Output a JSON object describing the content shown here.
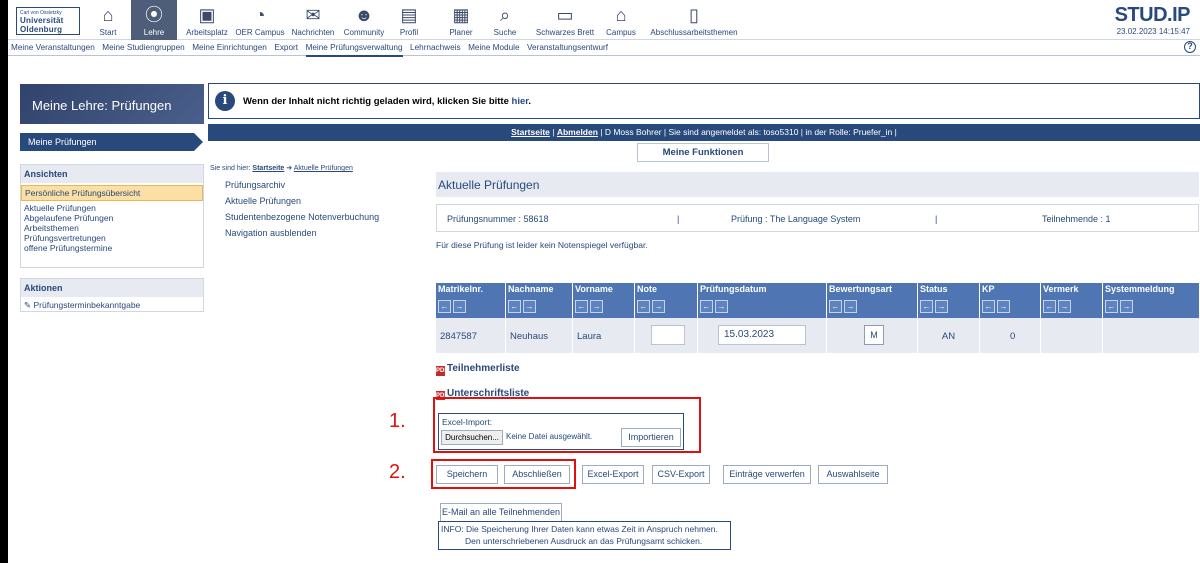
{
  "logo": {
    "small": "Carl von Ossietzky",
    "line1": "Universität",
    "line2": "Oldenburg"
  },
  "nav": [
    {
      "label": "Start",
      "icon": "home-icon",
      "glyph": "⌂"
    },
    {
      "label": "Lehre",
      "icon": "lehre-icon",
      "glyph": "⦿"
    },
    {
      "label": "Arbeitsplatz",
      "icon": "workplace-icon",
      "glyph": "▣"
    },
    {
      "label": "OER Campus",
      "icon": "oer-icon",
      "glyph": "◔"
    },
    {
      "label": "Nachrichten",
      "icon": "mail-icon",
      "glyph": "✉"
    },
    {
      "label": "Community",
      "icon": "community-icon",
      "glyph": "☻"
    },
    {
      "label": "Profil",
      "icon": "profile-icon",
      "glyph": "▤"
    },
    {
      "label": "Planer",
      "icon": "calendar-icon",
      "glyph": "▦"
    },
    {
      "label": "Suche",
      "icon": "search-icon",
      "glyph": "⌕"
    },
    {
      "label": "Schwarzes Brett",
      "icon": "board-icon",
      "glyph": "▭"
    },
    {
      "label": "Campus",
      "icon": "campus-icon",
      "glyph": "⌂"
    },
    {
      "label": "Abschlussarbeitsthemen",
      "icon": "thesis-icon",
      "glyph": "▯"
    }
  ],
  "brand": "STUD.IP",
  "datetime": "23.02.2023 14:15:47",
  "subnav": [
    "Meine Veranstaltungen",
    "Meine Studiengruppen",
    "Meine Einrichtungen",
    "Export",
    "Meine Prüfungsverwaltung",
    "Lehrnachweis",
    "Meine Module",
    "Veranstaltungsentwurf"
  ],
  "sidebar": {
    "title": "Meine Lehre: Prüfungen",
    "tab": "Meine Prüfungen",
    "ansichten_title": "Ansichten",
    "ansichten": [
      "Persönliche Prüfungsübersicht",
      "Aktuelle Prüfungen",
      "Abgelaufene Prüfungen",
      "Arbeitsthemen",
      "Prüfungsvertretungen",
      "offene Prüfungstermine"
    ],
    "aktionen_title": "Aktionen",
    "aktion": "Prüfungsterminbekanntgabe"
  },
  "banner": {
    "text": "Wenn der Inhalt nicht richtig geladen wird, klicken Sie bitte ",
    "link": "hier",
    "end": "."
  },
  "bluebar": {
    "start": "Startseite",
    "abmelden": "Abmelden",
    "rest": " | D Moss Bohrer | Sie sind angemeldet als: toso5310  |  in der Rolle: Pruefer_in |"
  },
  "funcs": "Meine Funktionen",
  "crumb": {
    "prefix": "Sie sind hier: ",
    "start": "Startseite",
    "arrow": " ➔ ",
    "current": "Aktuelle Prüfungen"
  },
  "midnav": [
    "Prüfungsarchiv",
    "Aktuelle Prüfungen",
    "Studentenbezogene Notenverbuchung",
    "Navigation ausblenden"
  ],
  "main_title": "Aktuelle Prüfungen",
  "info": {
    "nummer": "Prüfungsnummer : 58618",
    "sep": "|",
    "pruefung": "Prüfung : The Language System",
    "teilnehmende": "Teilnehmende : 1"
  },
  "notenspiegel": "Für diese Prüfung ist leider kein Notenspiegel verfügbar.",
  "table": {
    "headers": [
      "Matrikelnr.",
      "Nachname",
      "Vorname",
      "Note",
      "Prüfungsdatum",
      "Bewertungsart",
      "Status",
      "KP",
      "Vermerk",
      "Systemmeldung"
    ],
    "row": {
      "matrikel": "2847587",
      "nachname": "Neuhaus",
      "vorname": "Laura",
      "note": "",
      "datum": "15.03.2023",
      "bewertung": "M",
      "status": "AN",
      "kp": "0",
      "vermerk": "",
      "system": ""
    }
  },
  "links": {
    "teilnehmer": "Teilnehmerliste",
    "unterschrift": "Unterschriftsliste"
  },
  "excel": {
    "label": "Excel-Import:",
    "browse": "Durchsuchen...",
    "nofile": "Keine Datei ausgewählt.",
    "import": "Importieren"
  },
  "buttons": [
    "Speichern",
    "Abschließen",
    "Excel-Export",
    "CSV-Export",
    "Einträge verwerfen",
    "Auswahlseite"
  ],
  "email_btn": "E-Mail an alle Teilnehmenden",
  "infobox": {
    "line1": "INFO: Die Speicherung Ihrer Daten kann etwas Zeit in Anspruch nehmen.",
    "line2": "Den unterschriebenen Ausdruck an das Prüfungsamt schicken."
  },
  "steps": [
    "1.",
    "2."
  ],
  "colors": {
    "primary": "#28497c",
    "table_head": "#4f76b3",
    "highlight": "#e01010",
    "selected": "#fcdfa4"
  }
}
